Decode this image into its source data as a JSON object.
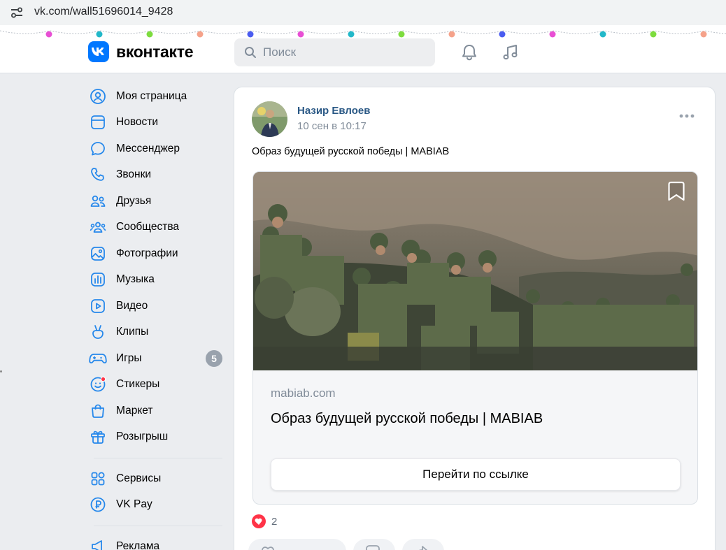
{
  "browser": {
    "url": "vk.com/wall51696014_9428"
  },
  "header": {
    "logo_text": "вконтакте",
    "search_placeholder": "Поиск",
    "icons": [
      "notifications-bell-icon",
      "music-note-icon"
    ]
  },
  "sidebar": {
    "items": [
      {
        "label": "Моя страница",
        "icon": "user-circle-icon"
      },
      {
        "label": "Новости",
        "icon": "newsfeed-icon"
      },
      {
        "label": "Мессенджер",
        "icon": "message-icon"
      },
      {
        "label": "Звонки",
        "icon": "phone-icon"
      },
      {
        "label": "Друзья",
        "icon": "friends-icon"
      },
      {
        "label": "Сообщества",
        "icon": "communities-icon"
      },
      {
        "label": "Фотографии",
        "icon": "photo-icon"
      },
      {
        "label": "Музыка",
        "icon": "music-icon"
      },
      {
        "label": "Видео",
        "icon": "video-icon"
      },
      {
        "label": "Клипы",
        "icon": "clips-icon"
      },
      {
        "label": "Игры",
        "icon": "gamepad-icon",
        "badge": "5"
      },
      {
        "label": "Стикеры",
        "icon": "sticker-icon"
      },
      {
        "label": "Маркет",
        "icon": "market-bag-icon"
      },
      {
        "label": "Розыгрыш",
        "icon": "gift-icon"
      }
    ],
    "items2": [
      {
        "label": "Сервисы",
        "icon": "services-icon"
      },
      {
        "label": "VK Pay",
        "icon": "vkpay-icon"
      }
    ],
    "items3": [
      {
        "label": "Реклама",
        "icon": "ads-megaphone-icon"
      }
    ]
  },
  "post": {
    "author": "Назир Евлоев",
    "date": "10 сен в 10:17",
    "text": "Образ будущей русской победы | MABIAB",
    "link": {
      "domain": "mabiab.com",
      "title": "Образ будущей русской победы | MABIAB",
      "button": "Перейти по ссылке"
    },
    "likes": "2"
  },
  "colors": {
    "accent": "#0077ff",
    "author_link": "#2a5885",
    "like_red": "#ff3347",
    "badge": "#99a2ad"
  }
}
